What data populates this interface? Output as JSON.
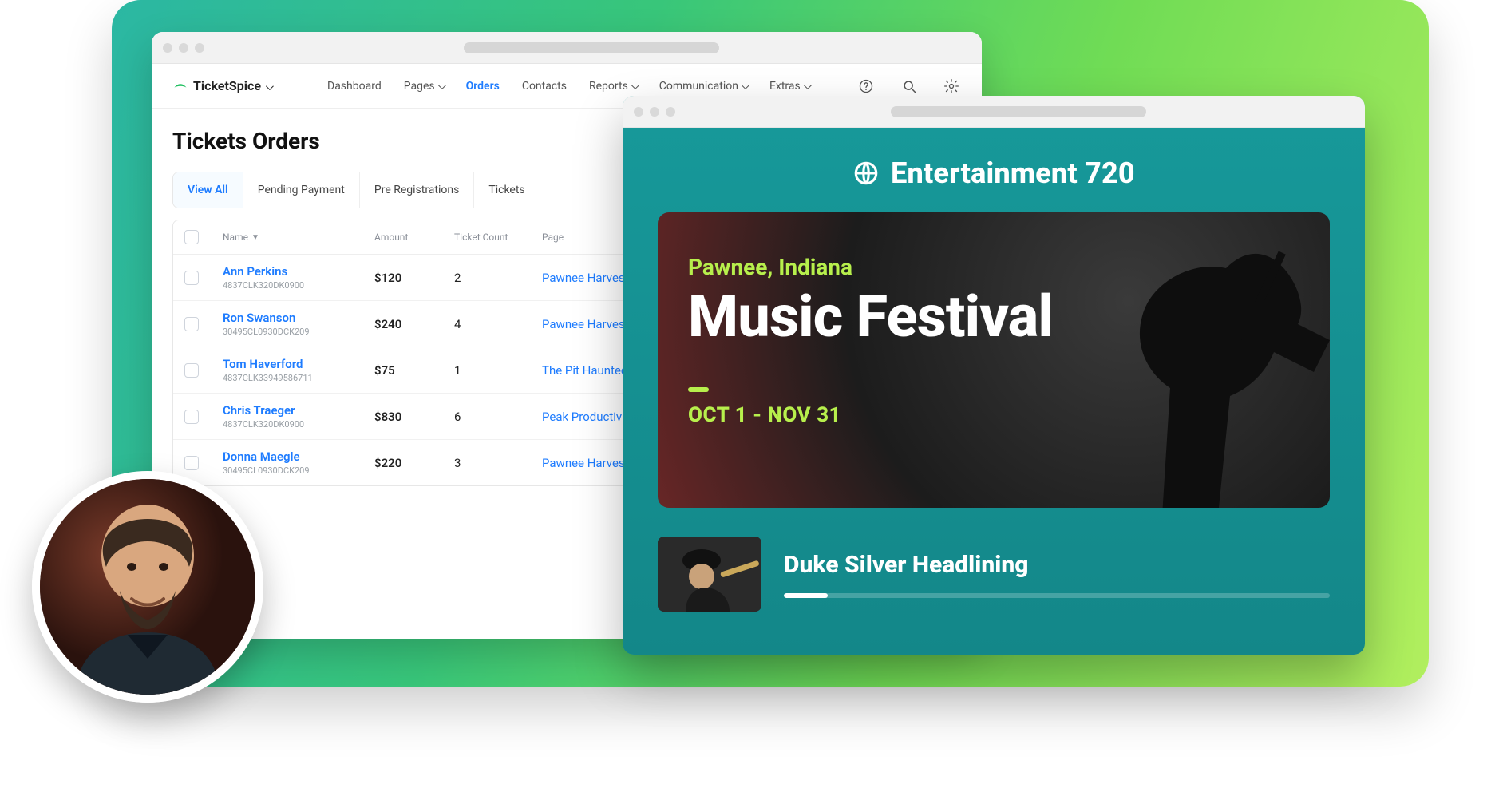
{
  "app": {
    "logo_text": "TicketSpice",
    "nav": {
      "dashboard": "Dashboard",
      "pages": "Pages",
      "orders": "Orders",
      "contacts": "Contacts",
      "reports": "Reports",
      "communication": "Communication",
      "extras": "Extras"
    }
  },
  "orders": {
    "title": "Tickets Orders",
    "tabs": {
      "view_all": "View All",
      "pending": "Pending Payment",
      "prereg": "Pre Registrations",
      "tickets": "Tickets"
    },
    "search_placeholder": "Search",
    "columns": {
      "name": "Name",
      "amount": "Amount",
      "ticket_count": "Ticket Count",
      "page": "Page"
    },
    "rows": [
      {
        "name": "Ann Perkins",
        "code": "4837CLK320DK0900",
        "amount": "$120",
        "count": "2",
        "page": "Pawnee Harvest Festival"
      },
      {
        "name": "Ron Swanson",
        "code": "30495CL0930DCK209",
        "amount": "$240",
        "count": "4",
        "page": "Pawnee Harvest Festival"
      },
      {
        "name": "Tom Haverford",
        "code": "4837CLK33949586711",
        "amount": "$75",
        "count": "1",
        "page": "The Pit Haunted House"
      },
      {
        "name": "Chris Traeger",
        "code": "4837CLK320DK0900",
        "amount": "$830",
        "count": "6",
        "page": "Peak Productivity Workshop"
      },
      {
        "name": "Donna Maegle",
        "code": "30495CL0930DCK209",
        "amount": "$220",
        "count": "3",
        "page": "Pawnee Harvest Festival"
      }
    ]
  },
  "event_site": {
    "brand": "Entertainment 720",
    "location": "Pawnee, Indiana",
    "title": "Music Festival",
    "dates": "OCT 1 - NOV 31",
    "listing_title": "Duke Silver Headlining"
  },
  "testimonial": {
    "line1": "",
    "line2": ""
  }
}
